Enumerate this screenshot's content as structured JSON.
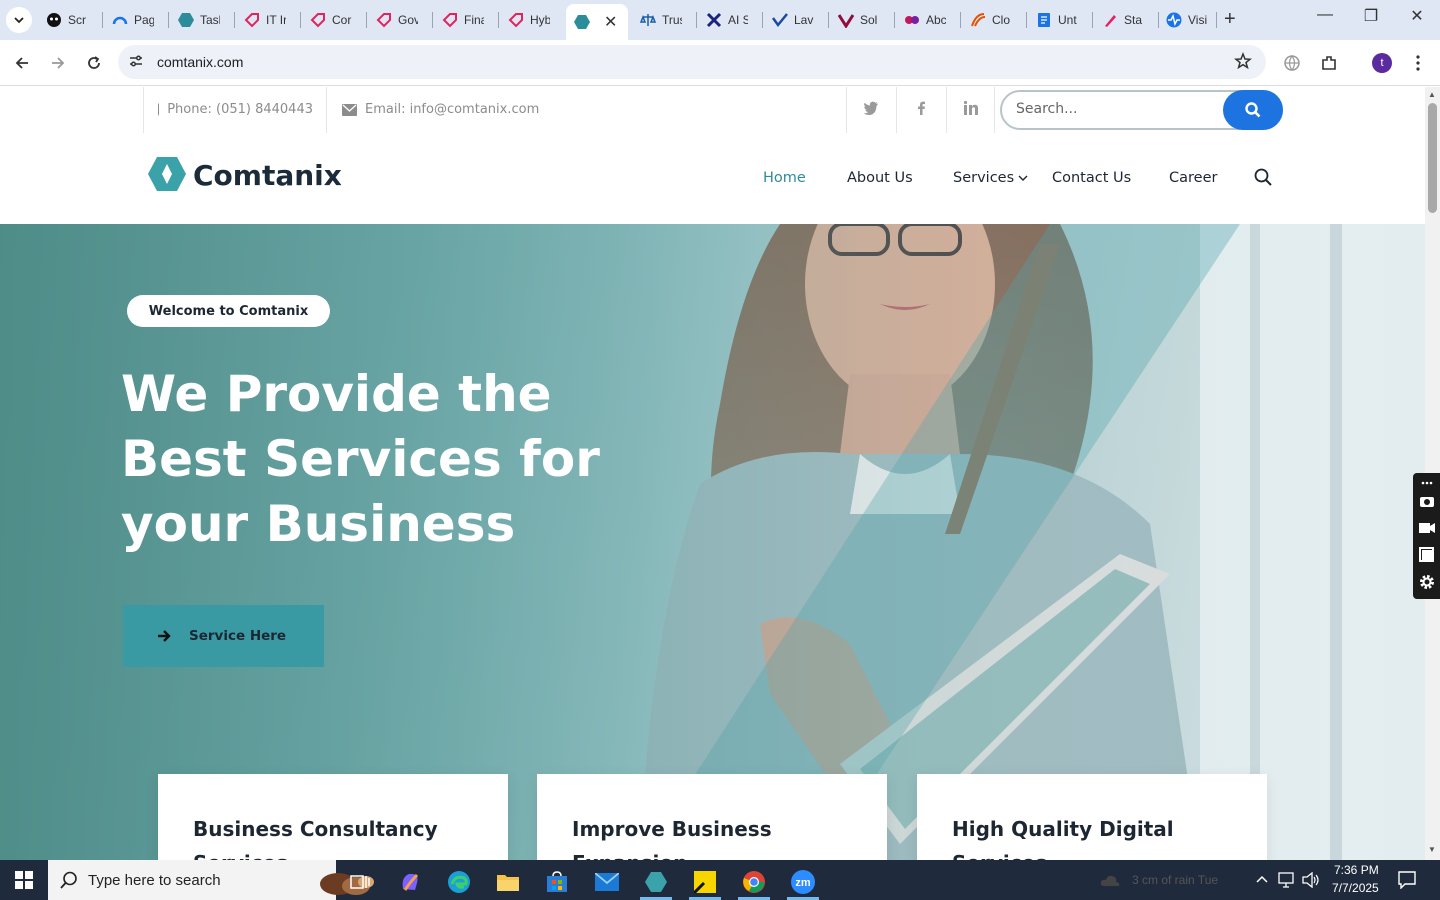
{
  "browser": {
    "tabs": [
      {
        "label": "Scr",
        "icon": "bear-face-icon",
        "color": "#111111"
      },
      {
        "label": "Pag",
        "icon": "gauge-icon",
        "color": "#1a73e8"
      },
      {
        "label": "Tasl",
        "icon": "comtanix-icon",
        "color": "#2d8c9a"
      },
      {
        "label": "IT Ir",
        "icon": "tag-icon",
        "color": "#e0245e"
      },
      {
        "label": "Cor",
        "icon": "tag-icon",
        "color": "#e0245e"
      },
      {
        "label": "Gov",
        "icon": "tag-icon",
        "color": "#e0245e"
      },
      {
        "label": "Fina",
        "icon": "tag-icon",
        "color": "#e0245e"
      },
      {
        "label": "Hyb",
        "icon": "tag-icon",
        "color": "#e0245e"
      },
      {
        "label": "",
        "icon": "comtanix-icon",
        "color": "#2d8c9a",
        "active": true
      },
      {
        "label": "Trus",
        "icon": "scales-icon",
        "color": "#1a5ea8"
      },
      {
        "label": "AI S",
        "icon": "x-brand-icon",
        "color": "#1a237e"
      },
      {
        "label": "Lav",
        "icon": "check-brand-icon",
        "color": "#1a4a9e"
      },
      {
        "label": "Sol",
        "icon": "v-brand-icon",
        "color": "#8e0e3c"
      },
      {
        "label": "Abc",
        "icon": "dots-brand-icon",
        "color": "#c2185b"
      },
      {
        "label": "Clo",
        "icon": "swoosh-icon",
        "color": "#e65100"
      },
      {
        "label": "Unt",
        "icon": "docs-icon",
        "color": "#1a73e8"
      },
      {
        "label": "Sta",
        "icon": "pen-icon",
        "color": "#e91e63"
      },
      {
        "label": "Visi",
        "icon": "pulse-icon",
        "color": "#1a73e8"
      }
    ],
    "url": "comtanix.com",
    "profile_initial": "t"
  },
  "topbar": {
    "phone": "Phone: (051) 8440443",
    "email": "Email: info@comtanix.com",
    "search_placeholder": "Search..."
  },
  "header": {
    "logo_text": "Comtanix",
    "menu": [
      {
        "label": "Home",
        "active": true
      },
      {
        "label": "About Us"
      },
      {
        "label": "Services",
        "has_dropdown": true
      },
      {
        "label": "Contact Us"
      },
      {
        "label": "Career"
      }
    ]
  },
  "hero": {
    "welcome": "Welcome to Comtanix",
    "title": "We Provide the Best Services for your Business",
    "button_label": "Service Here"
  },
  "cards": [
    {
      "title": "Business Consultancy Services"
    },
    {
      "title": "Improve Business Expansion"
    },
    {
      "title": "High Quality Digital Services"
    }
  ],
  "taskbar": {
    "search_placeholder": "Type here to search",
    "weather": "3 cm of rain Tue",
    "time": "7:36 PM",
    "date": "7/7/2025"
  },
  "colors": {
    "accent": "#2d8c9a",
    "search_button": "#1d74e0",
    "hero_button": "#3a9aa3"
  }
}
